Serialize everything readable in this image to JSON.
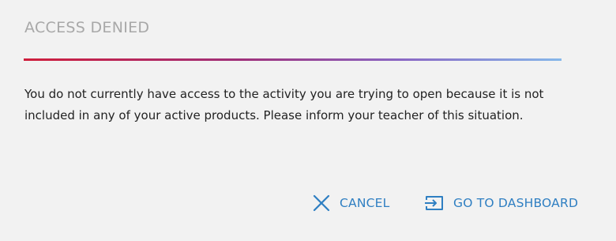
{
  "dialog": {
    "title": "ACCESS DENIED",
    "message": "You do not currently have access to the activity you are trying to open because it is not included in any of your active products. Please inform your teacher of this situation.",
    "actions": {
      "cancel": {
        "label": "CANCEL",
        "icon": "close-icon"
      },
      "dashboard": {
        "label": "GO TO DASHBOARD",
        "icon": "enter-dashboard-icon"
      }
    }
  },
  "colors": {
    "background": "#f2f2f2",
    "title": "#a8a8a8",
    "text": "#222222",
    "accent": "#2f7fc2",
    "divider_start": "#cf1e3c",
    "divider_end": "#86b8ea"
  }
}
